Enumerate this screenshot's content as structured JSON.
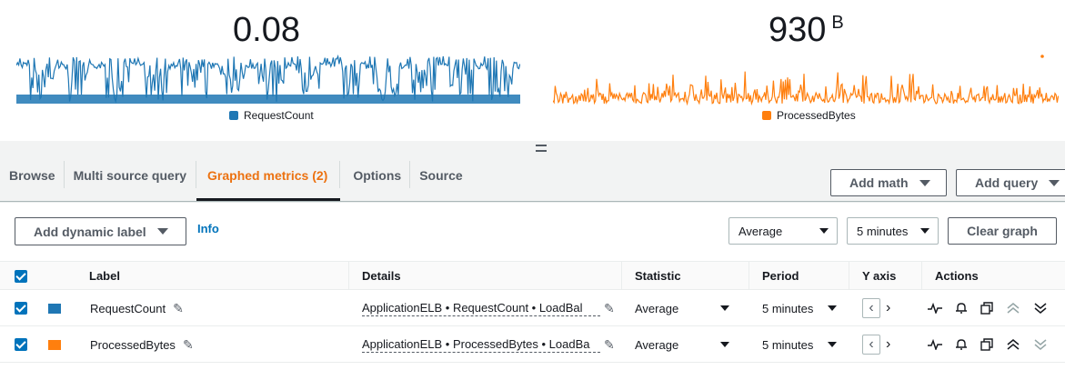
{
  "widgets": [
    {
      "value": "0.08",
      "unit": "",
      "legend": "RequestCount",
      "color": "#1f77b4"
    },
    {
      "value": "930",
      "unit": "B",
      "legend": "ProcessedBytes",
      "color": "#ff7f0e"
    }
  ],
  "tabs": [
    {
      "label": "Browse"
    },
    {
      "label": "Multi source query"
    },
    {
      "label": "Graphed metrics (2)"
    },
    {
      "label": "Options"
    },
    {
      "label": "Source"
    }
  ],
  "toolbar": {
    "add_math": "Add math",
    "add_query": "Add query",
    "add_dynamic_label": "Add dynamic label",
    "info": "Info",
    "statistic_select": "Average",
    "period_select": "5 minutes",
    "clear_graph": "Clear graph"
  },
  "table": {
    "headers": {
      "label": "Label",
      "details": "Details",
      "statistic": "Statistic",
      "period": "Period",
      "yaxis": "Y axis",
      "actions": "Actions"
    },
    "rows": [
      {
        "label": "RequestCount",
        "color": "#1f77b4",
        "details": "ApplicationELB • RequestCount • LoadBal",
        "statistic": "Average",
        "period": "5 minutes"
      },
      {
        "label": "ProcessedBytes",
        "color": "#ff7f0e",
        "details": "ApplicationELB • ProcessedBytes • LoadBa",
        "statistic": "Average",
        "period": "5 minutes"
      }
    ]
  }
}
